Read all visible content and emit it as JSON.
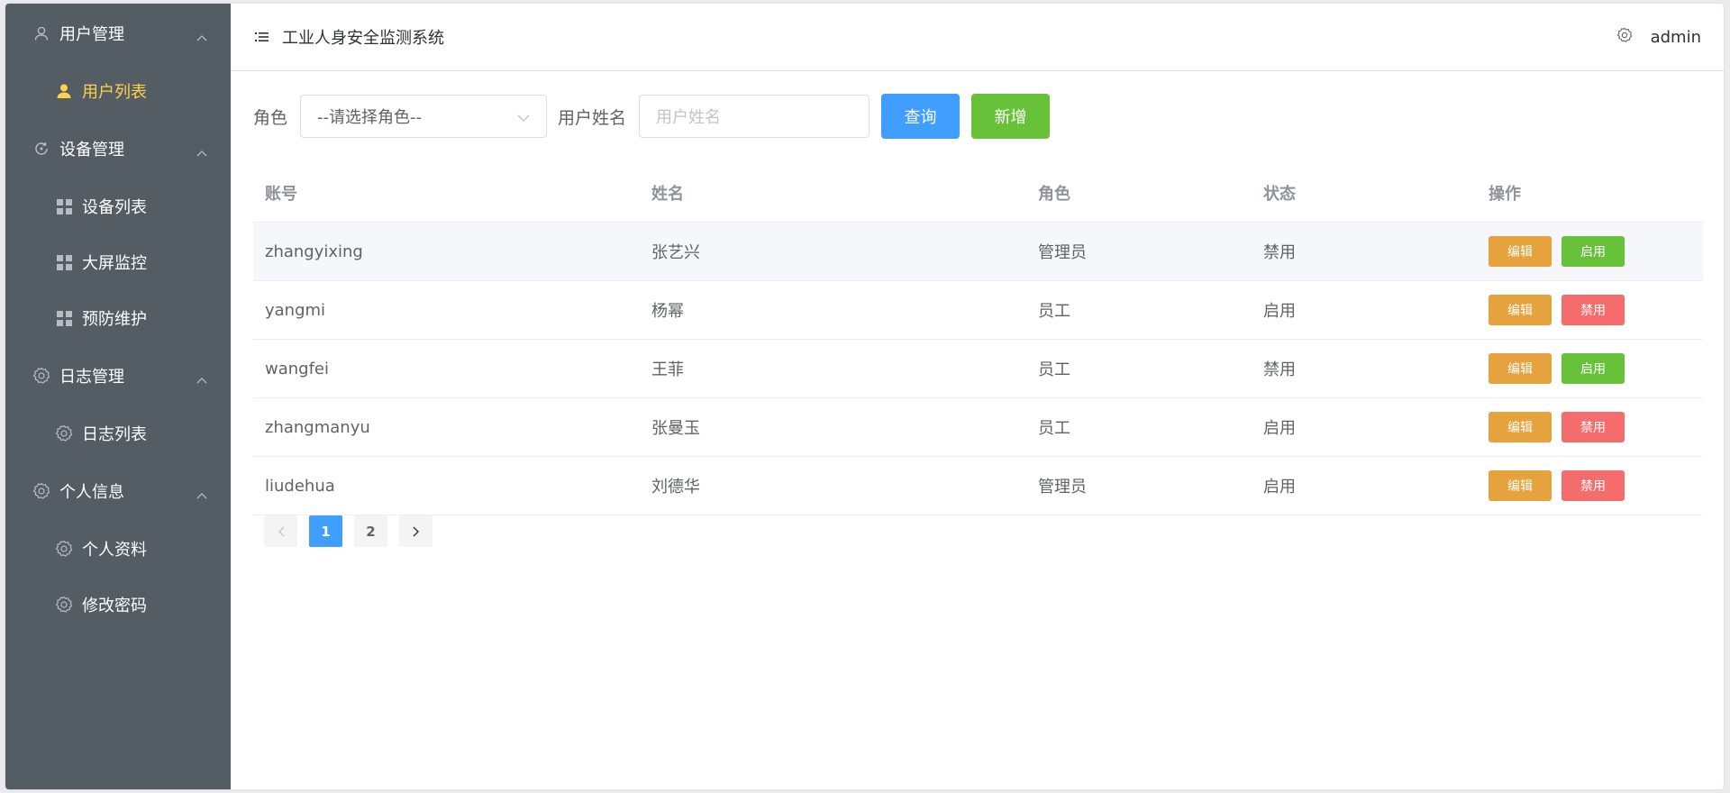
{
  "sidebar": {
    "groups": [
      {
        "label": "用户管理",
        "items": [
          {
            "label": "用户列表"
          }
        ]
      },
      {
        "label": "设备管理",
        "items": [
          {
            "label": "设备列表"
          },
          {
            "label": "大屏监控"
          },
          {
            "label": "预防维护"
          }
        ]
      },
      {
        "label": "日志管理",
        "items": [
          {
            "label": "日志列表"
          }
        ]
      },
      {
        "label": "个人信息",
        "items": [
          {
            "label": "个人资料"
          },
          {
            "label": "修改密码"
          }
        ]
      }
    ]
  },
  "header": {
    "title": "工业人身安全监测系统",
    "user": "admin"
  },
  "filters": {
    "role_label": "角色",
    "role_select_value": "--请选择角色--",
    "name_label": "用户姓名",
    "name_placeholder": "用户姓名",
    "query_label": "查询",
    "add_label": "新增"
  },
  "table": {
    "columns": [
      "账号",
      "姓名",
      "角色",
      "状态",
      "操作"
    ],
    "rows": [
      {
        "account": "zhangyixing",
        "name": "张艺兴",
        "role": "管理员",
        "status": "禁用",
        "edit": "编辑",
        "toggle": "启用"
      },
      {
        "account": "yangmi",
        "name": "杨幂",
        "role": "员工",
        "status": "启用",
        "edit": "编辑",
        "toggle": "禁用"
      },
      {
        "account": "wangfei",
        "name": "王菲",
        "role": "员工",
        "status": "禁用",
        "edit": "编辑",
        "toggle": "启用"
      },
      {
        "account": "zhangmanyu",
        "name": "张曼玉",
        "role": "员工",
        "status": "启用",
        "edit": "编辑",
        "toggle": "禁用"
      },
      {
        "account": "liudehua",
        "name": "刘德华",
        "role": "管理员",
        "status": "启用",
        "edit": "编辑",
        "toggle": "禁用"
      }
    ]
  },
  "pagination": {
    "pages": [
      "1",
      "2"
    ],
    "current": "1"
  },
  "colors": {
    "sidebar_bg": "#545c64",
    "active_menu": "#ffd04b",
    "primary": "#409eff",
    "success": "#67c23a",
    "warning": "#e6a23c",
    "danger": "#f56c6c"
  }
}
